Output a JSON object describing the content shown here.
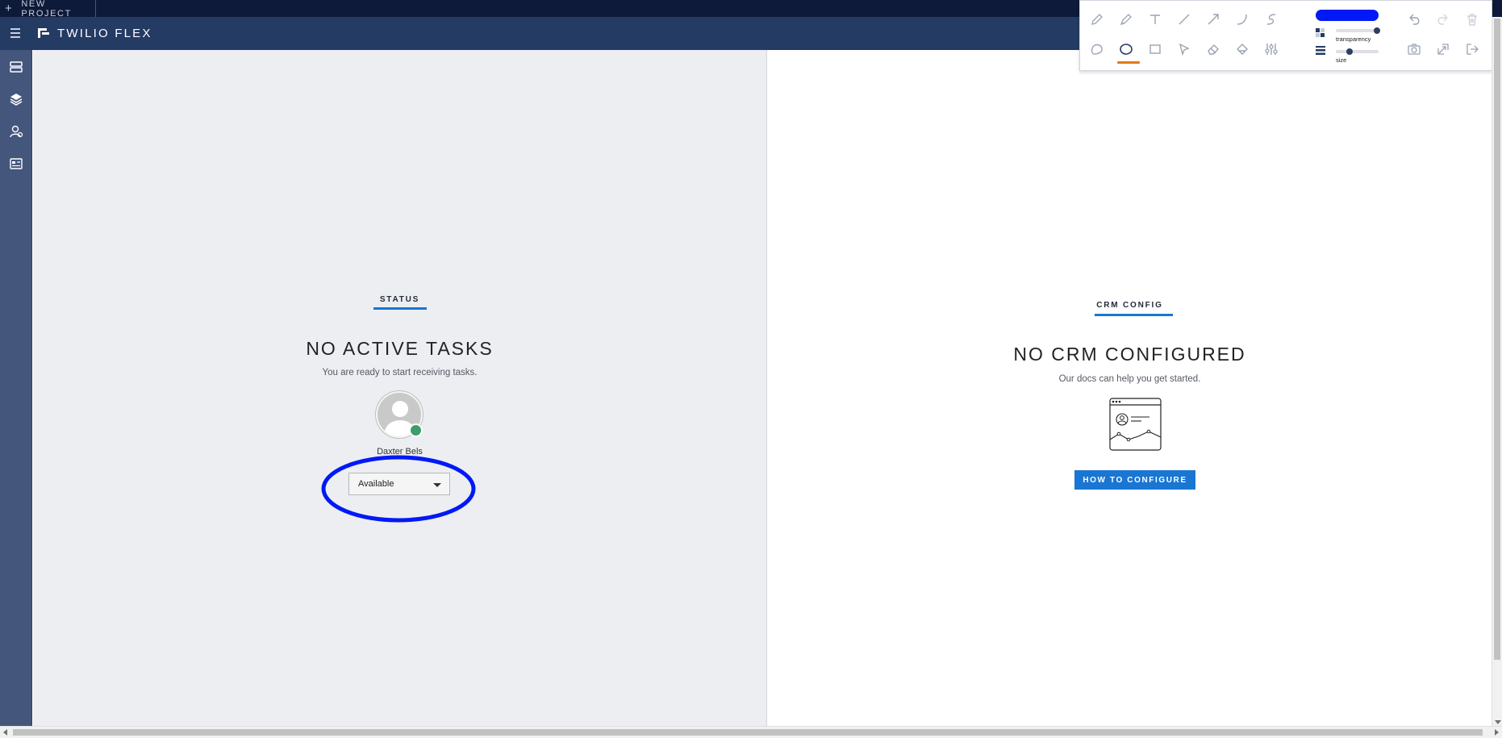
{
  "topbar": {
    "new_project_label": "NEW PROJECT",
    "plus_glyph": "+"
  },
  "header": {
    "brand": "TWILIO FLEX"
  },
  "leftnav": {
    "items": [
      {
        "icon": "queues-icon"
      },
      {
        "icon": "layers-icon"
      },
      {
        "icon": "teams-icon"
      },
      {
        "icon": "dashboard-icon"
      }
    ]
  },
  "status_panel": {
    "tab_label": "STATUS",
    "heading": "NO ACTIVE TASKS",
    "subtext": "You are ready to start receiving tasks.",
    "agent_name": "Daxter Bels",
    "availability": "Available",
    "presence_color": "#3f9c6b"
  },
  "crm_panel": {
    "tab_label": "CRM CONFIG",
    "heading": "NO CRM CONFIGURED",
    "subtext": "Our docs can help you get started.",
    "button_label": "HOW TO CONFIGURE"
  },
  "annotation_toolbar": {
    "selected_tool": "ellipse",
    "color": "#0019f5",
    "transparency_label": "transparency",
    "size_label": "size",
    "transparency_level": 1.0,
    "size_level": 0.3,
    "tools_row1": [
      "pencil-icon",
      "marker-icon",
      "text-icon",
      "line-icon",
      "arrow-icon",
      "curve-icon",
      "freehand-icon"
    ],
    "tools_row2": [
      "lasso-icon",
      "ellipse-icon",
      "rectangle-icon",
      "pointer-icon",
      "eraser-icon",
      "fill-icon",
      "settings-sliders-icon"
    ],
    "actions_row1": [
      "undo-icon",
      "redo-icon",
      "trash-icon"
    ],
    "actions_row2": [
      "camera-icon",
      "capture-region-icon",
      "exit-icon"
    ]
  },
  "colors": {
    "topbar": "#0e1a3a",
    "header": "#243b64",
    "accent": "#1976d2",
    "annotation_blue": "#0019f5"
  }
}
